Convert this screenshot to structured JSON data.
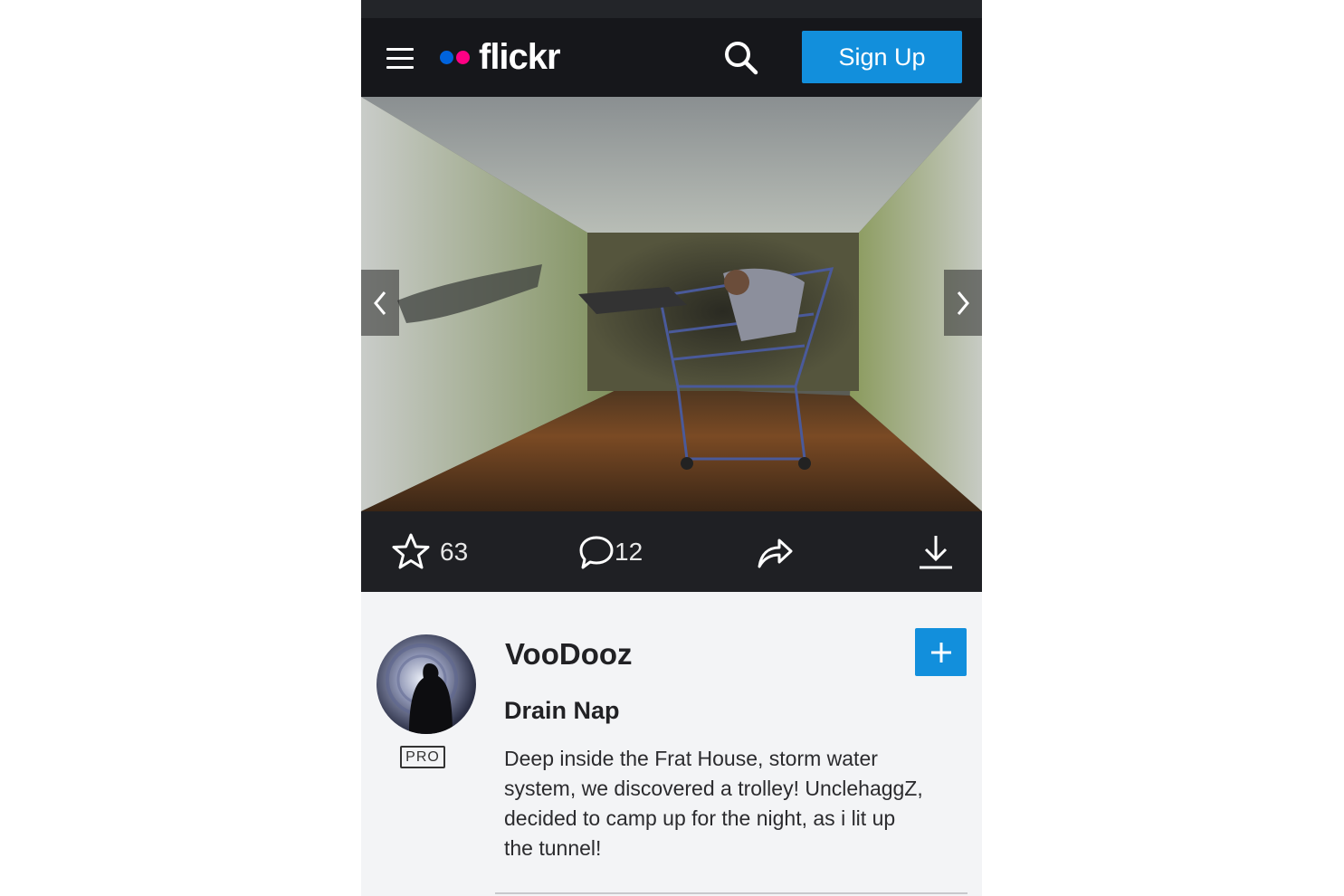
{
  "header": {
    "logo_text": "flickr",
    "signup_label": "Sign Up",
    "colors": {
      "brand_blue": "#0063dc",
      "brand_pink": "#ff0084",
      "accent": "#128fdc"
    }
  },
  "icons": {
    "menu": "hamburger-menu-icon",
    "search": "search-icon",
    "prev": "chevron-left-icon",
    "next": "chevron-right-icon",
    "fave": "star-icon",
    "comment": "comment-bubble-icon",
    "share": "share-arrow-icon",
    "download": "download-icon",
    "follow": "plus-icon"
  },
  "stats": {
    "faves": "63",
    "comments": "12"
  },
  "owner": {
    "name": "VooDooz",
    "badge": "PRO"
  },
  "photo": {
    "title": "Drain Nap",
    "description": "Deep inside the Frat House, storm water system, we discovered a trolley! UnclehaggZ, decided to camp up for the night, as i lit up the tunnel!"
  }
}
